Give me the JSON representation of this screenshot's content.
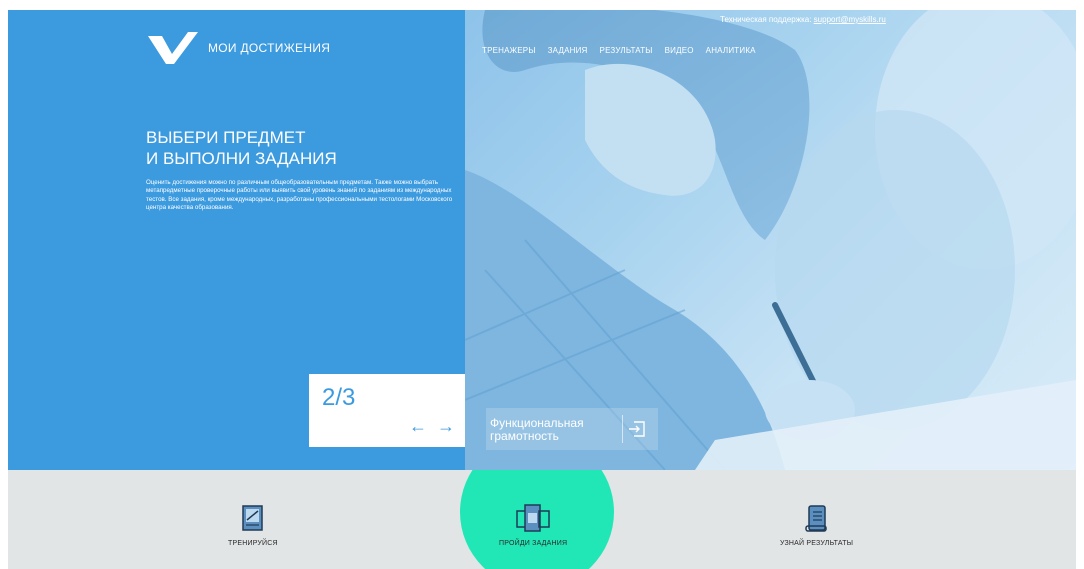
{
  "header": {
    "logo_text": "МОИ ДОСТИЖЕНИЯ",
    "support_label": "Техническая поддержка:",
    "support_email": "support@myskills.ru",
    "nav": [
      {
        "label": "ТРЕНАЖЕРЫ"
      },
      {
        "label": "ЗАДАНИЯ"
      },
      {
        "label": "РЕЗУЛЬТАТЫ"
      },
      {
        "label": "ВИДЕО"
      },
      {
        "label": "АНАЛИТИКА"
      }
    ]
  },
  "hero": {
    "headline_line1": "ВЫБЕРИ ПРЕДМЕТ",
    "headline_line2": "И ВЫПОЛНИ ЗАДАНИЯ",
    "lead": "Оценить достижения можно по различным общеобразовательным предметам. Также можно выбрать метапредметные проверочные работы или выявить свой уровень знаний по заданиям из международных тестов. Все задания, кроме международных, разработаны профессиональными тестологами Московского центра качества образования.",
    "slider": {
      "counter": "2/3",
      "prev": "←",
      "next": "→"
    },
    "slide_caption": "Функциональная грамотность"
  },
  "features": [
    {
      "label": "ТРЕНИРУЙСЯ",
      "icon": "training-book-icon"
    },
    {
      "label": "ПРОЙДИ ЗАДАНИЯ",
      "icon": "tasks-devices-icon"
    },
    {
      "label": "УЗНАЙ РЕЗУЛЬТАТЫ",
      "icon": "results-scroll-icon"
    }
  ],
  "colors": {
    "brand_blue": "#3c9adf",
    "accent_mint": "#21e7b6",
    "bottom_bg": "#e2e5e6"
  }
}
